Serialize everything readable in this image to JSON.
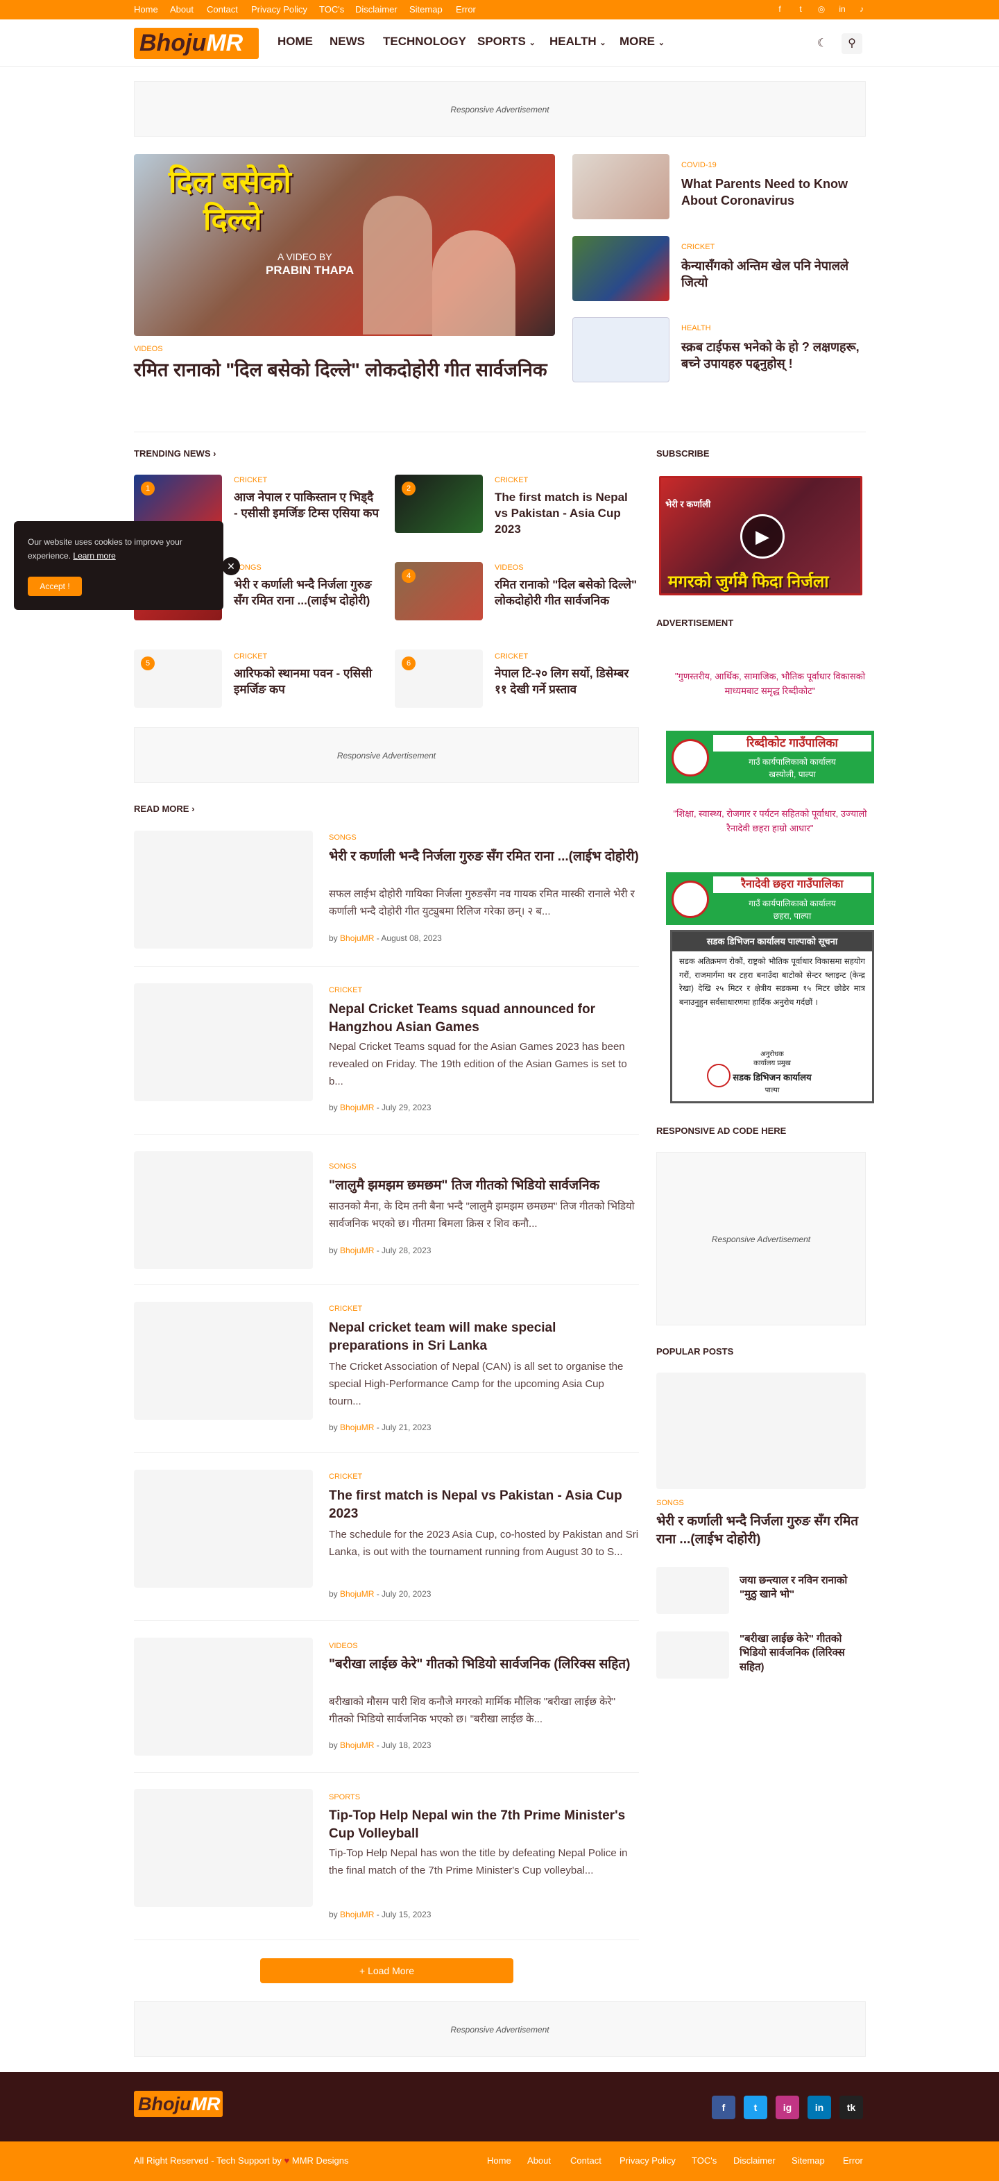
{
  "topbar": {
    "links": [
      "Home",
      "About",
      "Contact",
      "Privacy Policy",
      "TOC's",
      "Disclaimer",
      "Sitemap",
      "Error"
    ],
    "social_icons": [
      "facebook-icon",
      "twitter-icon",
      "instagram-icon",
      "linkedin-icon",
      "tiktok-icon"
    ]
  },
  "header": {
    "logo_part1": "Bhoju",
    "logo_part2": "MR",
    "nav": [
      "HOME",
      "NEWS",
      "TECHNOLOGY",
      "SPORTS",
      "HEALTH",
      "MORE"
    ],
    "dark_mode_icon": "moon-icon",
    "search_icon": "search-icon"
  },
  "ads": {
    "top": "Responsive Advertisement",
    "middle": "Responsive Advertisement",
    "bottom": "Responsive Advertisement",
    "sidebar": "Responsive Advertisement"
  },
  "hero": {
    "image_title_line1": "दिल बसेको",
    "image_title_line2": "दिल्ले",
    "image_caption1": "A VIDEO BY",
    "image_caption2": "PRABIN THAPA",
    "category": "VIDEOS",
    "title": "रमित रानाको \"दिल बसेको दिल्ले\" लोकदोहोरी गीत सार्वजनिक"
  },
  "featured_side": [
    {
      "category": "COVID-19",
      "title": "What Parents Need to Know About Coronavirus"
    },
    {
      "category": "CRICKET",
      "title": "केन्यासँगको अन्तिम खेल पनि नेपालले जित्यो"
    },
    {
      "category": "HEALTH",
      "title": "स्क्रब टाईफस भनेको के हो ? लक्षणहरू, बच्ने उपायहरु पढ्नुहोस् !"
    }
  ],
  "trending": {
    "heading": "TRENDING NEWS",
    "items": [
      {
        "rank": "1",
        "category": "CRICKET",
        "title": "आज नेपाल र पाकिस्तान ए भिड्दै - एसीसी इमर्जिङ टिम्स एसिया कप"
      },
      {
        "rank": "2",
        "category": "CRICKET",
        "title": "The first match is Nepal vs Pakistan - Asia Cup 2023"
      },
      {
        "rank": "3",
        "category": "SONGS",
        "title": "भेरी र कर्णाली भन्दै निर्जला गुरुङ सँग रमित राना ...(लाईभ दोहोरी)"
      },
      {
        "rank": "4",
        "category": "VIDEOS",
        "title": "रमित रानाको \"दिल बसेको दिल्ले\" लोकदोहोरी गीत सार्वजनिक"
      },
      {
        "rank": "5",
        "category": "CRICKET",
        "title": "आरिफको स्थानमा पवन - एसिसी इमर्जिङ कप"
      },
      {
        "rank": "6",
        "category": "CRICKET",
        "title": "नेपाल टि-२० लिग सर्यो, डिसेम्बर ११ देखी गर्ने प्रस्ताव"
      }
    ]
  },
  "cookie": {
    "text": "Our website uses cookies to improve your experience.",
    "learn_more": "Learn more",
    "accept": "Accept !"
  },
  "read_more": {
    "heading": "READ MORE",
    "posts": [
      {
        "category": "SONGS",
        "title": "भेरी र कर्णाली भन्दै निर्जला गुरुङ सँग रमित राना ...(लाईभ दोहोरी)",
        "excerpt": "सफल लाईभ दोहोरी गायिका निर्जला गुरुङसँग नव गायक रमित मास्की रानाले भेरी र कर्णाली भन्दै दोहोरी गीत युट्युबमा रिलिज गरेका छन्। २ ब...",
        "author": "BhojuMR",
        "date": "August 08, 2023"
      },
      {
        "category": "CRICKET",
        "title": "Nepal Cricket Teams squad announced for Hangzhou Asian Games",
        "excerpt": "Nepal Cricket Teams squad for the Asian Games 2023 has been revealed on Friday. The 19th edition of the Asian Games is set to b...",
        "author": "BhojuMR",
        "date": "July 29, 2023"
      },
      {
        "category": "SONGS",
        "title": "\"लालुमै झमझम छमछम\" तिज गीतको भिडियो सार्वजनिक",
        "excerpt": "साउनको मैना, के दिम तनी बैना भन्दै \"लालुमै झमझम छमछम\" तिज गीतको भिडियो सार्वजनिक भएको छ। गीतमा बिमला क्रिस र शिव कनौ...",
        "author": "BhojuMR",
        "date": "July 28, 2023"
      },
      {
        "category": "CRICKET",
        "title": "Nepal cricket team will make special preparations in Sri Lanka",
        "excerpt": "The Cricket Association of Nepal (CAN) is all set to organise the special High-Performance Camp for the upcoming Asia Cup tourn...",
        "author": "BhojuMR",
        "date": "July 21, 2023"
      },
      {
        "category": "CRICKET",
        "title": "The first match is Nepal vs Pakistan - Asia Cup 2023",
        "excerpt": "The schedule for the 2023 Asia Cup, co-hosted by Pakistan and Sri Lanka, is out with the tournament running from August 30 to S...",
        "author": "BhojuMR",
        "date": "July 20, 2023"
      },
      {
        "category": "VIDEOS",
        "title": "\"बरीखा लाईछ केरे\" गीतको भिडियो सार्वजनिक (लिरिक्स सहित)",
        "excerpt": "बरीखाको मौसम पारी शिव कनौजे मगरको मार्मिक मौलिक \"बरीखा लाईछ केरे\" गीतको भिडियो सार्वजनिक भएको छ। \"बरीखा लाईछ के...",
        "author": "BhojuMR",
        "date": "July 18, 2023"
      },
      {
        "category": "SPORTS",
        "title": "Tip-Top Help Nepal win the 7th Prime Minister's Cup Volleyball",
        "excerpt": "Tip-Top Help Nepal has won the title by defeating Nepal Police in the final match of the 7th Prime Minister's Cup volleybal...",
        "author": "BhojuMR",
        "date": "July 15, 2023"
      }
    ],
    "load_more": "Load More"
  },
  "sidebar": {
    "subscribe_heading": "SUBSCRIBE",
    "video_text1": "भेरी र कर्णाली",
    "video_text2": "मगरको जुर्गमै फिदा निर्जला",
    "ad_heading": "ADVERTISEMENT",
    "slogan1": "\"गुणस्तरीय, आर्थिक, सामाजिक, भौतिक पूर्वाधार विकासको माध्यमबाट समृद्ध रिब्दीकोट\"",
    "banner1_title": "रिब्दीकोट गाउँपालिका",
    "banner1_sub1": "गाउँ कार्यपालिकाको कार्यालय",
    "banner1_sub2": "खस्योली, पाल्पा",
    "slogan2": "\"शिक्षा, स्वास्थ्य, रोजगार र पर्यटन सहितको पूर्वाधार, उज्यालो रैनादेवी छहरा हाम्रो आधार\"",
    "banner2_title": "रैनादेवी छहरा गाउँपालिका",
    "banner2_sub1": "गाउँ कार्यपालिकाको कार्यालय",
    "banner2_sub2": "छहरा, पाल्पा",
    "notice_title": "सडक डिभिजन कार्यालय पाल्पाको सूचना",
    "notice_body": "सडक अतिक्रमण रोकौं, राष्ट्रको भौतिक पूर्वाधार विकासमा सहयोग गरौं, राजमार्गमा घर टहरा बनाउँदा बाटोको सेन्टर ष्लाइन्ट (केन्द्र रेखा) देखि २५ मिटर र क्षेत्रीय सडकमा १५ मिटर छोडेर मात्र बनाउनुहुन सर्वसाधारणमा हार्दिक अनुरोध गर्दछौं ।",
    "notice_sign1": "अनुरोधक",
    "notice_sign2": "कार्यालय प्रमुख",
    "notice_sign3": "सडक डिभिजन कार्यालय",
    "notice_sign4": "पाल्पा",
    "responsive_heading": "RESPONSIVE AD CODE HERE",
    "popular_heading": "POPULAR POSTS",
    "popular_main_category": "SONGS",
    "popular_main_title": "भेरी र कर्णाली भन्दै निर्जला गुरुङ सँग रमित राना ...(लाईभ दोहोरी)",
    "popular_items": [
      "जया छन्त्याल र नविन रानाको \"मुठु खाने भो\"",
      "\"बरीखा लाईछ केरे\" गीतको भिडियो सार्वजनिक (लिरिक्स सहित)"
    ]
  },
  "footer": {
    "logo_part1": "Bhoju",
    "logo_part2": "MR",
    "social": [
      "f",
      "t",
      "ig",
      "in",
      "tk"
    ],
    "copyright": "All Right Reserved - Tech Support by",
    "support_name": "MMR Designs",
    "links": [
      "Home",
      "About",
      "Contact",
      "Privacy Policy",
      "TOC's",
      "Disclaimer",
      "Sitemap",
      "Error"
    ]
  },
  "colors": {
    "accent": "#ff8c00",
    "dark": "#3a1414",
    "text": "#3a1f1f"
  }
}
